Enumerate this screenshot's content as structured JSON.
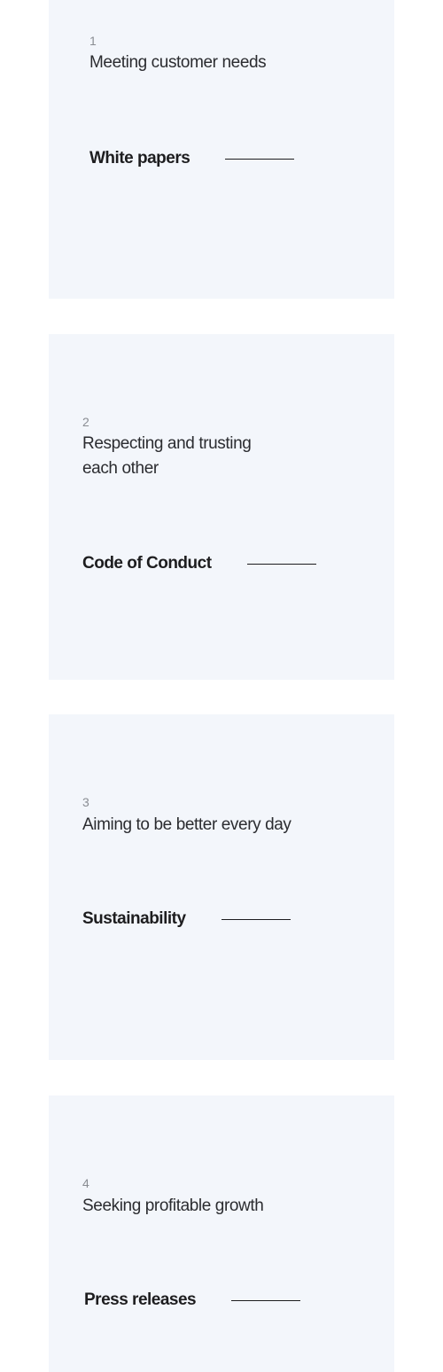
{
  "cards": [
    {
      "number": "1",
      "heading": "Meeting customer needs",
      "link_label": "White papers"
    },
    {
      "number": "2",
      "heading": "Respecting and trusting each other",
      "link_label": "Code of Conduct"
    },
    {
      "number": "3",
      "heading": "Aiming to be better every day",
      "link_label": "Sustainability"
    },
    {
      "number": "4",
      "heading": "Seeking profitable growth",
      "link_label": "Press releases"
    }
  ],
  "colors": {
    "card_background": "#f3f6fb",
    "text": "#1d1d1f",
    "number_text": "#8a8d93"
  }
}
